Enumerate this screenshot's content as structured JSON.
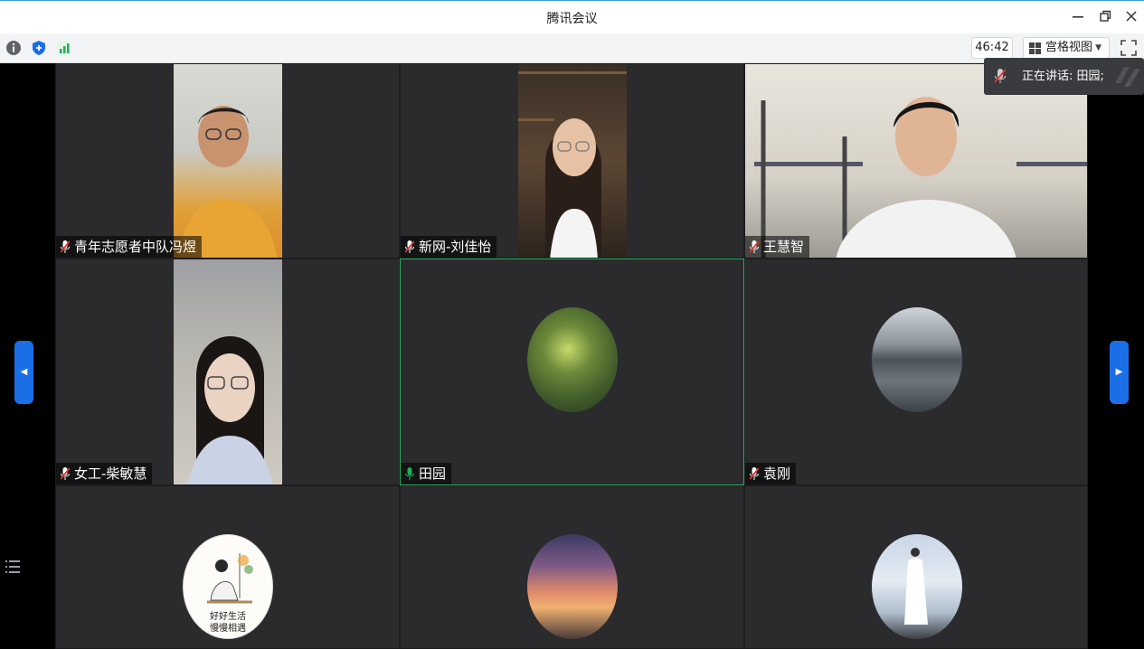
{
  "window": {
    "title": "腾讯会议"
  },
  "toolbar": {
    "timer": "46:42",
    "view_label": "宫格视图"
  },
  "speaking": {
    "text": "正在讲话: 田园;"
  },
  "participants": [
    {
      "name": "青年志愿者中队冯煜",
      "mic": "muted"
    },
    {
      "name": "新网-刘佳怡",
      "mic": "muted"
    },
    {
      "name": "王慧智",
      "mic": "muted"
    },
    {
      "name": "女工-柴敏慧",
      "mic": "muted"
    },
    {
      "name": "田园",
      "mic": "active"
    },
    {
      "name": "袁刚",
      "mic": "muted"
    },
    {
      "name": "",
      "mic": "none"
    },
    {
      "name": "",
      "mic": "none"
    },
    {
      "name": "",
      "mic": "none"
    }
  ],
  "avatar_texts": {
    "poster_line1": "好好生活",
    "poster_line2": "慢慢相遇"
  },
  "colors": {
    "accent": "#1b6fe6",
    "active_speaker": "#22b05a",
    "muted_mic": "#e0322f"
  }
}
